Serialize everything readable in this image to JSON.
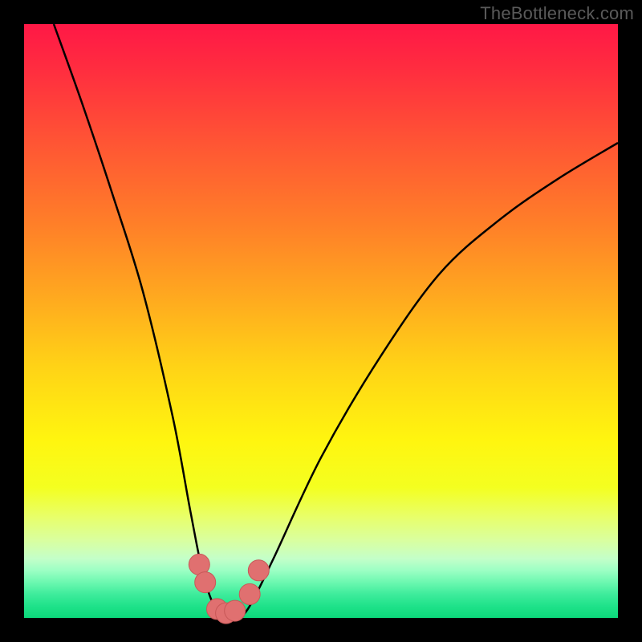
{
  "watermark": "TheBottleneck.com",
  "chart_data": {
    "type": "line",
    "title": "",
    "xlabel": "",
    "ylabel": "",
    "xlim": [
      0,
      100
    ],
    "ylim": [
      0,
      100
    ],
    "series": [
      {
        "name": "bottleneck-curve",
        "x": [
          5,
          10,
          15,
          20,
          25,
          28,
          30,
          32,
          34,
          36,
          38,
          42,
          50,
          60,
          70,
          80,
          90,
          100
        ],
        "values": [
          100,
          86,
          71,
          55,
          34,
          18,
          8,
          2,
          0,
          0,
          2,
          10,
          27,
          44,
          58,
          67,
          74,
          80
        ]
      }
    ],
    "markers": [
      {
        "name": "lobe-left-upper",
        "x": 29.5,
        "y": 9
      },
      {
        "name": "lobe-left-lower",
        "x": 30.5,
        "y": 6
      },
      {
        "name": "lobe-bottom-1",
        "x": 32.5,
        "y": 1.5
      },
      {
        "name": "lobe-bottom-2",
        "x": 34.0,
        "y": 0.8
      },
      {
        "name": "lobe-bottom-3",
        "x": 35.5,
        "y": 1.2
      },
      {
        "name": "lobe-right-lower",
        "x": 38.0,
        "y": 4
      },
      {
        "name": "lobe-right-upper",
        "x": 39.5,
        "y": 8
      }
    ],
    "colors": {
      "curve_stroke": "#000000",
      "marker_fill": "#e07070",
      "marker_stroke": "#c85858"
    }
  }
}
